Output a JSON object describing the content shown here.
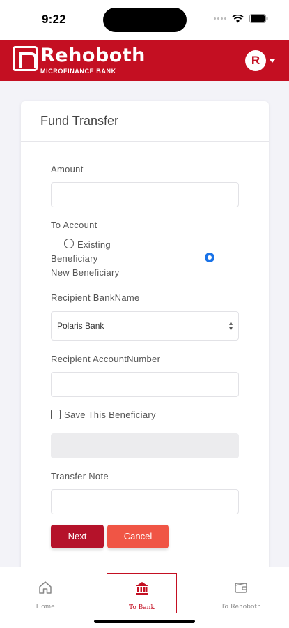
{
  "status_bar": {
    "time": "9:22"
  },
  "header": {
    "brand": "Rehoboth",
    "brand_sub": "MICROFINANCE BANK"
  },
  "card": {
    "title": "Fund Transfer"
  },
  "form": {
    "amount_label": "Amount",
    "amount_value": "",
    "to_account_label": "To Account",
    "option_existing_line1": "Existing",
    "option_existing_line2": "Beneficiary",
    "option_new": "New Beneficiary",
    "selected_option": "New Beneficiary",
    "bank_label": "Recipient BankName",
    "bank_selected": "Polaris Bank",
    "account_number_label": "Recipient AccountNumber",
    "account_number_value": "",
    "save_beneficiary_label": "Save This Beneficiary",
    "save_beneficiary_checked": false,
    "transfer_note_label": "Transfer Note",
    "transfer_note_value": ""
  },
  "buttons": {
    "next": "Next",
    "cancel": "Cancel"
  },
  "bottom_nav": {
    "items": [
      {
        "label": "Home",
        "icon": "home-icon",
        "active": false
      },
      {
        "label": "To Bank",
        "icon": "bank-icon",
        "active": true
      },
      {
        "label": "To Rehoboth",
        "icon": "wallet-icon",
        "active": false
      }
    ]
  },
  "colors": {
    "brand_red": "#c40f22",
    "next_button": "#b5122a",
    "cancel_button": "#f05545",
    "radio_selected": "#1a73e8"
  }
}
